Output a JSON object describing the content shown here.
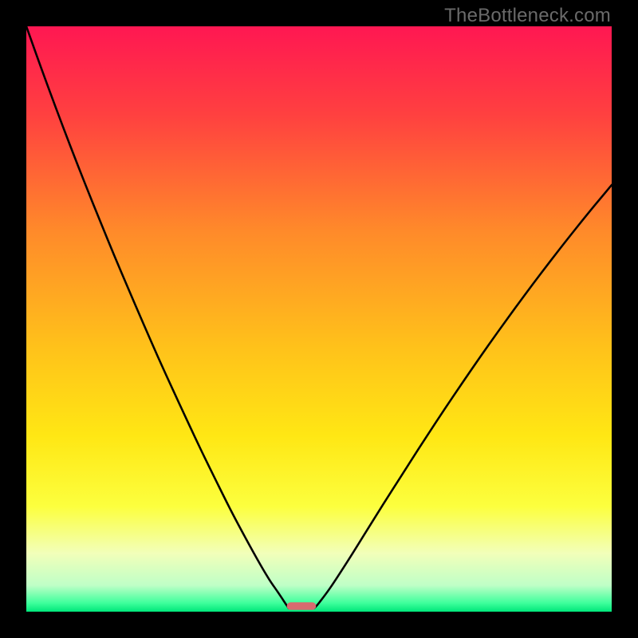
{
  "watermark": "TheBottleneck.com",
  "chart_data": {
    "type": "line",
    "title": "",
    "xlabel": "",
    "ylabel": "",
    "xlim": [
      0,
      100
    ],
    "ylim": [
      0,
      100
    ],
    "grid": false,
    "legend": false,
    "gradient_stops": [
      {
        "pos": 0.0,
        "color": "#ff1752"
      },
      {
        "pos": 0.15,
        "color": "#ff4040"
      },
      {
        "pos": 0.35,
        "color": "#ff8a2a"
      },
      {
        "pos": 0.55,
        "color": "#ffc21a"
      },
      {
        "pos": 0.7,
        "color": "#ffe714"
      },
      {
        "pos": 0.82,
        "color": "#fcff3e"
      },
      {
        "pos": 0.9,
        "color": "#f2ffb9"
      },
      {
        "pos": 0.955,
        "color": "#bfffc7"
      },
      {
        "pos": 0.985,
        "color": "#3fff9c"
      },
      {
        "pos": 1.0,
        "color": "#00e77a"
      }
    ],
    "series": [
      {
        "name": "left-curve",
        "x": [
          0.0,
          2.5,
          5.0,
          7.5,
          10.0,
          12.5,
          15.0,
          17.5,
          20.0,
          22.5,
          25.0,
          27.5,
          30.0,
          32.5,
          35.0,
          37.5,
          40.0,
          41.5,
          43.0,
          44.0,
          44.8
        ],
        "y": [
          100.0,
          93.0,
          86.2,
          79.6,
          73.2,
          67.0,
          60.9,
          55.0,
          49.2,
          43.5,
          38.0,
          32.6,
          27.3,
          22.2,
          17.2,
          12.5,
          8.0,
          5.5,
          3.3,
          1.8,
          0.6
        ]
      },
      {
        "name": "right-curve",
        "x": [
          49.2,
          50.0,
          52.0,
          55.0,
          58.0,
          61.0,
          64.0,
          67.0,
          70.0,
          73.0,
          76.0,
          79.0,
          82.0,
          85.0,
          88.0,
          91.0,
          94.0,
          97.0,
          100.0
        ],
        "y": [
          0.6,
          1.5,
          4.2,
          8.8,
          13.6,
          18.4,
          23.1,
          27.8,
          32.4,
          36.9,
          41.3,
          45.6,
          49.8,
          53.9,
          57.9,
          61.8,
          65.6,
          69.3,
          72.9
        ]
      }
    ],
    "marker": {
      "name": "bottom-pill",
      "x_center": 47.0,
      "width": 5.0,
      "color": "#d86a6f"
    }
  }
}
